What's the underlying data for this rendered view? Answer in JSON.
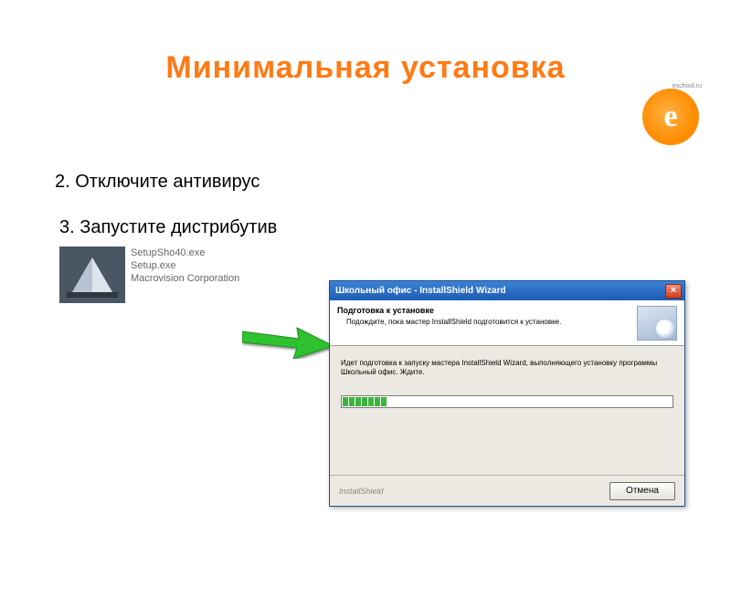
{
  "title": "Минимальная установка",
  "logo_text": "eschool.ru",
  "steps": {
    "s2": "2. Отключите антивирус",
    "s3": "3. Запустите дистрибутив"
  },
  "files": {
    "f1": "SetupSho40.exe",
    "f2": "Setup.exe",
    "f3": "Macrovision Corporation"
  },
  "wizard": {
    "title": "Школьный офис - InstallShield Wizard",
    "close": "×",
    "header_title": "Подготовка к установке",
    "header_sub": "Подождите, пока мастер InstallShield подготовится к установке.",
    "body_text": "Идет подготовка к запуску мастера InstallShield Wizard, выполняющего установку программы Школьный офис. Ждите.",
    "footer_brand": "InstallShield",
    "cancel": "Отмена"
  }
}
